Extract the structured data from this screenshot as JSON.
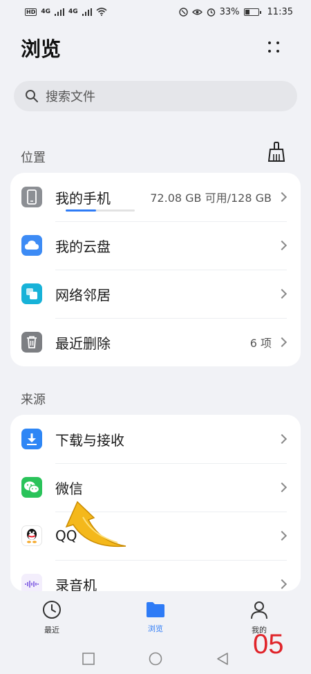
{
  "status_bar": {
    "hd": "HD",
    "sig1": "4G",
    "sig2": "4G",
    "battery": "33%",
    "time": "11:35"
  },
  "header": {
    "title": "浏览"
  },
  "search": {
    "placeholder": "搜索文件"
  },
  "sections": {
    "location_label": "位置",
    "source_label": "来源"
  },
  "location_items": [
    {
      "label": "我的手机",
      "value": "72.08 GB 可用/128 GB",
      "icon": "phone-icon",
      "storage_used_fraction": 0.44
    },
    {
      "label": "我的云盘",
      "value": "",
      "icon": "cloud-icon"
    },
    {
      "label": "网络邻居",
      "value": "",
      "icon": "network-icon"
    },
    {
      "label": "最近删除",
      "value": "6 项",
      "icon": "trash-icon"
    }
  ],
  "source_items": [
    {
      "label": "下载与接收",
      "icon": "download-icon"
    },
    {
      "label": "微信",
      "icon": "wechat-icon"
    },
    {
      "label": "QQ",
      "icon": "qq-icon"
    },
    {
      "label": "录音机",
      "icon": "recorder-icon"
    }
  ],
  "bottom_nav": [
    {
      "label": "最近",
      "icon": "clock-icon",
      "active": false
    },
    {
      "label": "浏览",
      "icon": "folder-icon",
      "active": true
    },
    {
      "label": "我的",
      "icon": "person-icon",
      "active": false
    }
  ],
  "annotation": {
    "number": "05"
  },
  "colors": {
    "accent": "#2e7bf6",
    "background": "#f1f2f6",
    "card": "#ffffff",
    "annotation_red": "#e0242a"
  }
}
